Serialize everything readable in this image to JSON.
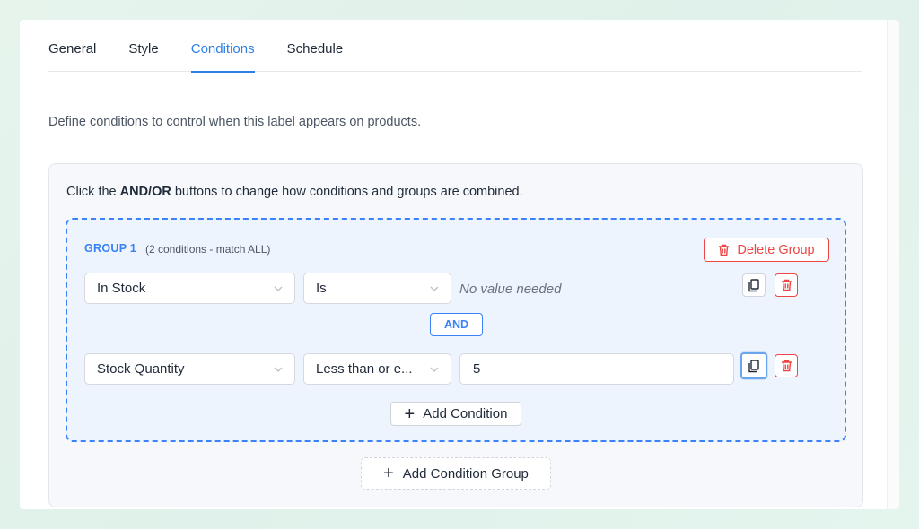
{
  "tabs": [
    {
      "label": "General"
    },
    {
      "label": "Style"
    },
    {
      "label": "Conditions",
      "active": true
    },
    {
      "label": "Schedule"
    }
  ],
  "intro": "Define conditions to control when this label appears on products.",
  "hint": {
    "before": "Click the ",
    "bold": "AND/OR",
    "after": " buttons to change how conditions and groups are combined."
  },
  "group": {
    "title": "GROUP 1",
    "subtitle": "(2 conditions - match ALL)",
    "delete_label": "Delete Group",
    "conditions": [
      {
        "field": "In Stock",
        "operator": "Is",
        "value_placeholder": "No value needed"
      },
      {
        "field": "Stock Quantity",
        "operator": "Less than or e...",
        "value": "5"
      }
    ],
    "connector": "AND",
    "add_condition_label": "Add Condition"
  },
  "add_group_label": "Add Condition Group",
  "colors": {
    "accent": "#3b82f6",
    "danger": "#ef4444",
    "group_bg": "#eef4fd"
  },
  "icons": [
    "chevron-down-icon",
    "copy-icon",
    "trash-icon",
    "plus-icon"
  ]
}
